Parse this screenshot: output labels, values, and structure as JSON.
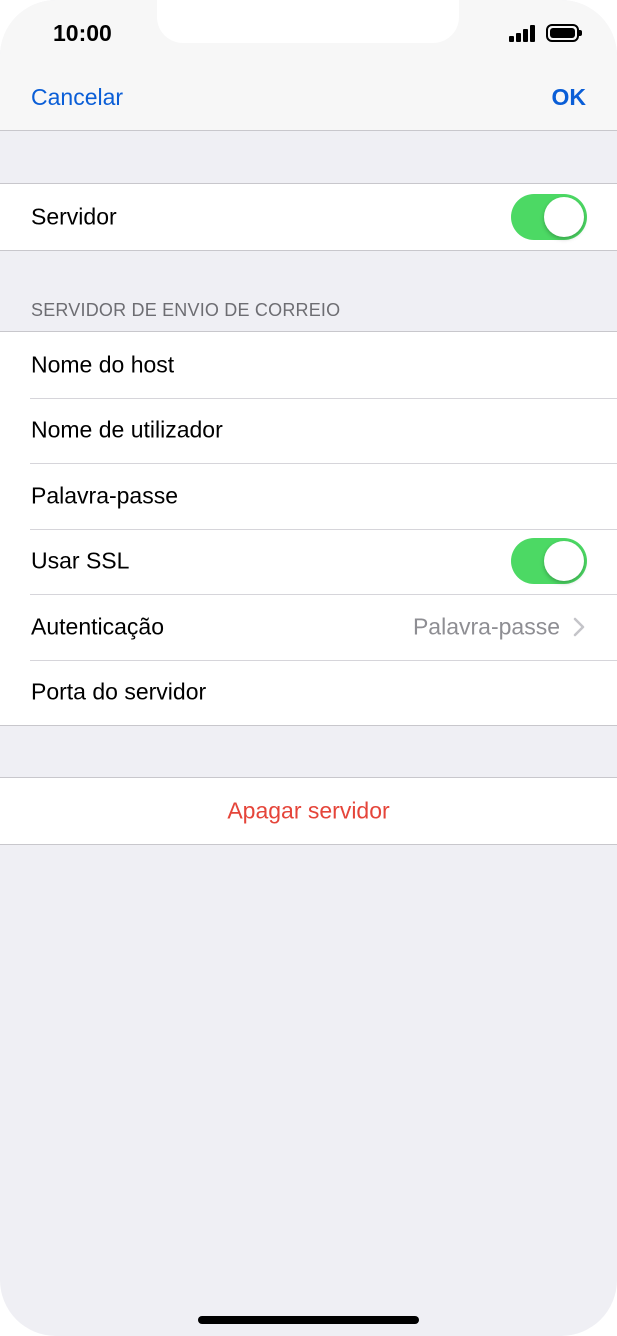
{
  "status_bar": {
    "time": "10:00",
    "signal_icon": "cellular-signal-icon",
    "battery_icon": "battery-icon"
  },
  "nav": {
    "cancel_label": "Cancelar",
    "ok_label": "OK",
    "accent_color": "#0a5ed7"
  },
  "server_toggle": {
    "label": "Servidor",
    "on": true
  },
  "outgoing_section": {
    "header": "SERVIDOR DE ENVIO DE CORREIO",
    "hostname_label": "Nome do host",
    "username_label": "Nome de utilizador",
    "password_label": "Palavra-passe",
    "ssl_label": "Usar SSL",
    "ssl_on": true,
    "auth_label": "Autenticação",
    "auth_value": "Palavra-passe",
    "port_label": "Porta do servidor"
  },
  "delete_server": {
    "label": "Apagar servidor",
    "color": "#e5453a"
  },
  "colors": {
    "toggle_on": "#4cd964",
    "background": "#efeff4"
  }
}
